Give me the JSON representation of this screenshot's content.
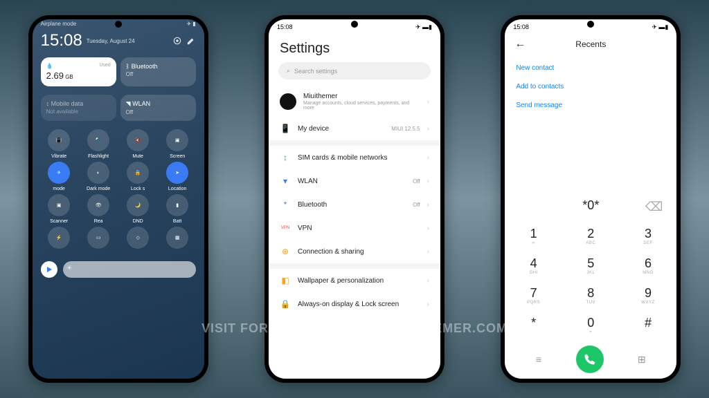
{
  "watermark": "VISIT FOR MORE THEMES - MIUITHEMER.COM",
  "p1": {
    "status_time": "15:08",
    "header": "Airplane mode",
    "clock": "15:08",
    "date": "Tuesday, August 24",
    "tile_data": {
      "label": "Used",
      "value": "2.69",
      "unit": "GB"
    },
    "tile_bt": {
      "title": "Bluetooth",
      "sub": "Off"
    },
    "tile_md": {
      "title": "Mobile data",
      "sub": "Not available"
    },
    "tile_wlan": {
      "title": "WLAN",
      "sub": "Off"
    },
    "toggles": [
      "Vibrate",
      "Flashlight",
      "Mute",
      "Screen",
      "mode",
      "Dark mode",
      "Lock s",
      "Location",
      "Scanner",
      "Rea",
      "DND",
      "Batt",
      "",
      "",
      "",
      ""
    ]
  },
  "p2": {
    "status_time": "15:08",
    "title": "Settings",
    "search": "Search settings",
    "account": {
      "name": "Miuithemer",
      "sub": "Manage accounts, cloud services, payments, and more"
    },
    "rows": [
      {
        "icon": "📱",
        "name": "My device",
        "val": "MIUI 12.5.5",
        "c": "#4b8bf5"
      },
      {
        "sep": true
      },
      {
        "icon": "↕",
        "name": "SIM cards & mobile networks",
        "c": "#1db954"
      },
      {
        "icon": "▾",
        "name": "WLAN",
        "val": "Off",
        "c": "#3b7af5"
      },
      {
        "icon": "*",
        "name": "Bluetooth",
        "val": "Off",
        "c": "#3b7af5"
      },
      {
        "icon": "VPN",
        "name": "VPN",
        "c": "#e8433a"
      },
      {
        "icon": "⊕",
        "name": "Connection & sharing",
        "c": "#f5a623"
      },
      {
        "sep": true
      },
      {
        "icon": "◧",
        "name": "Wallpaper & personalization",
        "c": "#f5a623"
      },
      {
        "icon": "🔒",
        "name": "Always-on display & Lock screen",
        "c": "#e8433a"
      }
    ]
  },
  "p3": {
    "status_time": "15:08",
    "title": "Recents",
    "links": [
      "New contact",
      "Add to contacts",
      "Send message"
    ],
    "input": "*0*",
    "keys": [
      {
        "n": "1",
        "l": "∞"
      },
      {
        "n": "2",
        "l": "ABC"
      },
      {
        "n": "3",
        "l": "DEF"
      },
      {
        "n": "4",
        "l": "GHI"
      },
      {
        "n": "5",
        "l": "JKL"
      },
      {
        "n": "6",
        "l": "MNO"
      },
      {
        "n": "7",
        "l": "PQRS"
      },
      {
        "n": "8",
        "l": "TUV"
      },
      {
        "n": "9",
        "l": "WXYZ"
      },
      {
        "n": "*",
        "l": ""
      },
      {
        "n": "0",
        "l": "+"
      },
      {
        "n": "#",
        "l": ""
      }
    ]
  }
}
